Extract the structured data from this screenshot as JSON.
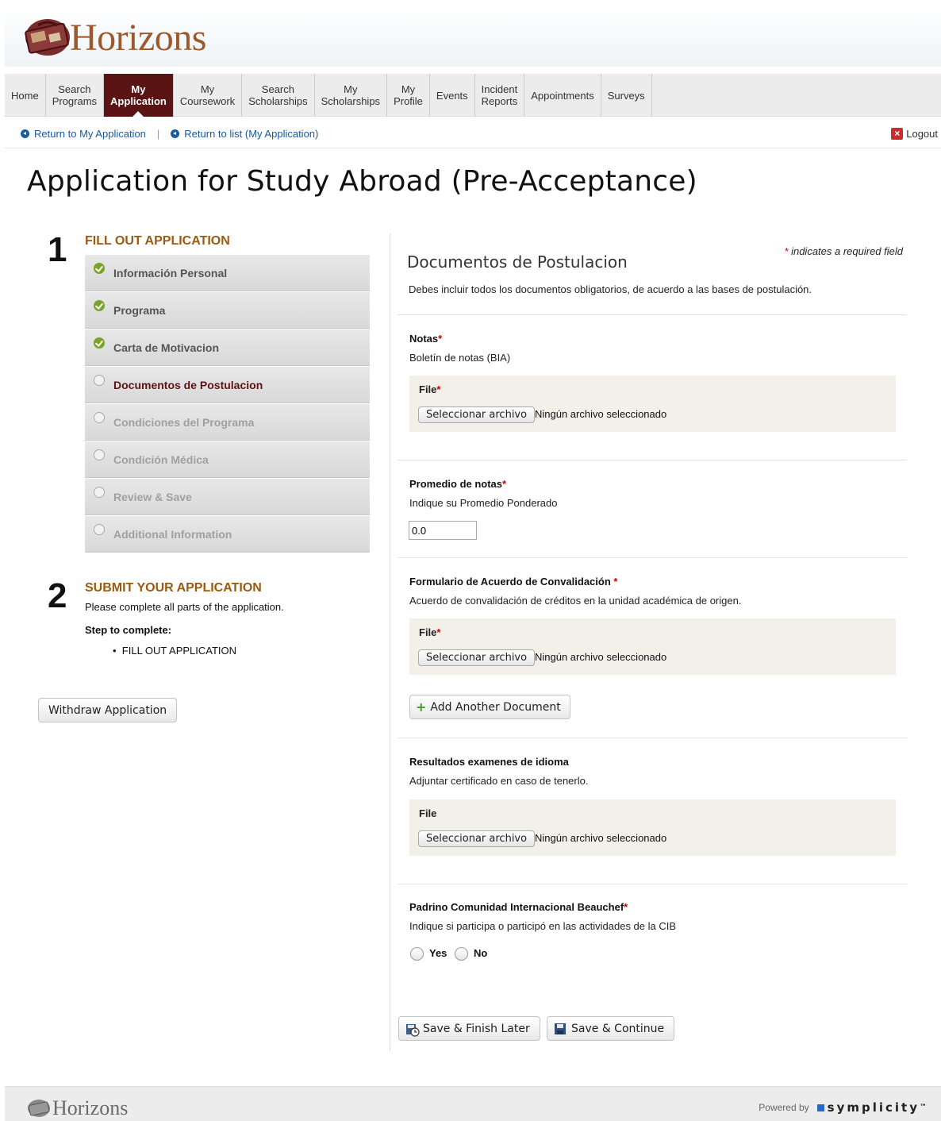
{
  "brand": {
    "name": "Horizons"
  },
  "nav": [
    {
      "label": "Home",
      "active": false
    },
    {
      "label": "Search\nPrograms",
      "active": false
    },
    {
      "label": "My\nApplication",
      "active": true
    },
    {
      "label": "My\nCoursework",
      "active": false
    },
    {
      "label": "Search\nScholarships",
      "active": false
    },
    {
      "label": "My\nScholarships",
      "active": false
    },
    {
      "label": "My\nProfile",
      "active": false
    },
    {
      "label": "Events",
      "active": false
    },
    {
      "label": "Incident\nReports",
      "active": false
    },
    {
      "label": "Appointments",
      "active": false
    },
    {
      "label": "Surveys",
      "active": false
    }
  ],
  "breadcrumb": {
    "return_app": "Return to My Application",
    "separator": "|",
    "return_list": "Return to list (My Application)"
  },
  "logout": "Logout",
  "page_title": "Application for Study Abroad (Pre-Acceptance)",
  "left": {
    "step1_num": "1",
    "step1_title": "FILL OUT APPLICATION",
    "steps": [
      {
        "label": "Información Personal",
        "status": "done"
      },
      {
        "label": "Programa",
        "status": "done"
      },
      {
        "label": "Carta de Motivacion",
        "status": "done"
      },
      {
        "label": "Documentos de Postulacion",
        "status": "current"
      },
      {
        "label": "Condiciones del Programa",
        "status": "future"
      },
      {
        "label": "Condición Médica",
        "status": "future"
      },
      {
        "label": "Review & Save",
        "status": "future"
      },
      {
        "label": "Additional Information",
        "status": "future"
      }
    ],
    "step2_num": "2",
    "step2_title": "SUBMIT YOUR APPLICATION",
    "step2_desc": "Please complete all parts of the application.",
    "step_to_complete": "Step to complete:",
    "todo_item": "FILL OUT APPLICATION",
    "withdraw": "Withdraw Application"
  },
  "form": {
    "required_note": "indicates a required field",
    "required_star": "*",
    "section_title": "Documentos de Postulacion",
    "section_desc": "Debes incluir todos los documentos obligatorios, de acuerdo a las bases de postulación.",
    "file_button": "Seleccionar archivo",
    "file_status": "Ningún archivo seleccionado",
    "notas": {
      "label": "Notas",
      "help": "Boletín de notas (BIA)",
      "file_label": "File"
    },
    "promedio": {
      "label": "Promedio de notas",
      "help": "Indique su Promedio Ponderado",
      "value": "0.0"
    },
    "convalidacion": {
      "label": "Formulario de Acuerdo de Convalidación ",
      "help": "Acuerdo de convalidación de créditos en la unidad académica de origen.",
      "file_label": "File",
      "add_another": "Add Another Document"
    },
    "idioma": {
      "label": "Resultados examenes de idioma",
      "help": "Adjuntar certificado en caso de tenerlo.",
      "file_label": "File"
    },
    "padrino": {
      "label": "Padrino Comunidad Internacional Beauchef",
      "help": "Indique si participa o participó en las actividades de la CIB",
      "yes": "Yes",
      "no": "No"
    },
    "save_later": "Save & Finish Later",
    "save_continue": "Save & Continue"
  },
  "footer": {
    "brand": "Horizons",
    "powered_by": "Powered by",
    "vendor": "symplicity",
    "tm": "™"
  },
  "colors": {
    "nav_active": "#5a1414",
    "step_title": "#9a5a10",
    "link": "#1a5aa0",
    "done": "#7aa32a",
    "required": "#cc0000"
  }
}
